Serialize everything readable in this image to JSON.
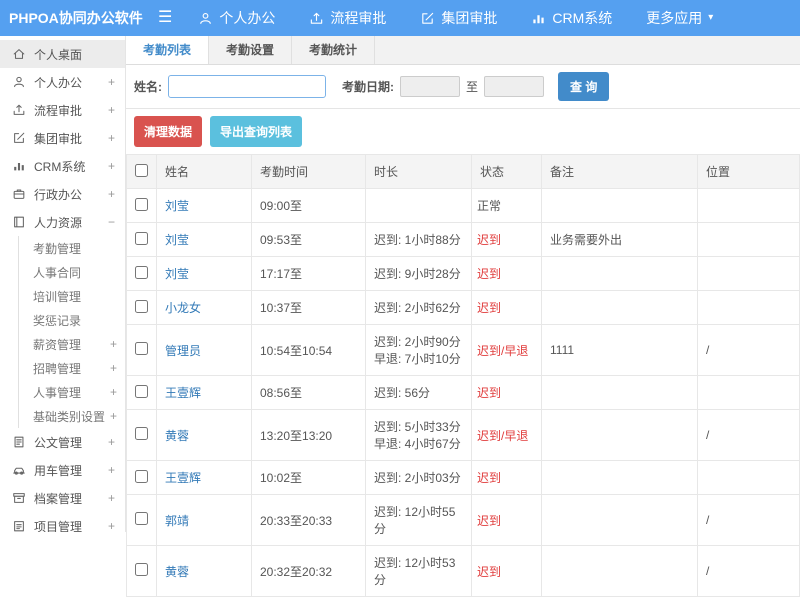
{
  "app": {
    "title": "PHPOA协同办公软件"
  },
  "topnav": {
    "menu_icon": "☰",
    "items": [
      {
        "label": "个人办公",
        "icon": "user"
      },
      {
        "label": "流程审批",
        "icon": "flow"
      },
      {
        "label": "集团审批",
        "icon": "edit"
      },
      {
        "label": "CRM系统",
        "icon": "chart"
      },
      {
        "label": "更多应用",
        "caret": "▾"
      }
    ]
  },
  "sidebar": {
    "items": [
      {
        "label": "个人桌面",
        "icon": "home",
        "cls": "active"
      },
      {
        "label": "个人办公",
        "icon": "user",
        "expand": "+"
      },
      {
        "label": "流程审批",
        "icon": "flow",
        "expand": "+"
      },
      {
        "label": "集团审批",
        "icon": "edit",
        "expand": "+"
      },
      {
        "label": "CRM系统",
        "icon": "chart",
        "expand": "+"
      },
      {
        "label": "行政办公",
        "icon": "briefcase",
        "expand": "+"
      },
      {
        "label": "人力资源",
        "icon": "book",
        "expand": "−"
      },
      {
        "label": "考勤管理",
        "cls": "sub"
      },
      {
        "label": "人事合同",
        "cls": "sub"
      },
      {
        "label": "培训管理",
        "cls": "sub"
      },
      {
        "label": "奖惩记录",
        "cls": "sub"
      },
      {
        "label": "薪资管理",
        "cls": "sub",
        "expand": "+"
      },
      {
        "label": "招聘管理",
        "cls": "sub",
        "expand": "+"
      },
      {
        "label": "人事管理",
        "cls": "sub",
        "expand": "+"
      },
      {
        "label": "基础类别设置",
        "cls": "sub",
        "expand": "+"
      },
      {
        "label": "公文管理",
        "icon": "doc",
        "expand": "+"
      },
      {
        "label": "用车管理",
        "icon": "car",
        "expand": "+"
      },
      {
        "label": "档案管理",
        "icon": "archive",
        "expand": "+"
      },
      {
        "label": "项目管理",
        "icon": "project",
        "expand": "+"
      }
    ]
  },
  "tabs": [
    {
      "label": "考勤列表",
      "cls": "active"
    },
    {
      "label": "考勤设置"
    },
    {
      "label": "考勤统计"
    }
  ],
  "filter": {
    "name_label": "姓名:",
    "date_label": "考勤日期:",
    "to_label": "至",
    "query_label": "查 询"
  },
  "actions": {
    "clear_label": "清理数据",
    "export_label": "导出查询列表"
  },
  "table": {
    "columns": [
      "姓名",
      "考勤时间",
      "时长",
      "状态",
      "备注",
      "位置"
    ],
    "rows": [
      {
        "name": "刘莹",
        "time": "09:00至",
        "duration": "",
        "status": "正常",
        "status_cls": "st-ok",
        "note": "",
        "location": ""
      },
      {
        "name": "刘莹",
        "time": "09:53至",
        "duration": "迟到: 1小时88分",
        "status": "迟到",
        "status_cls": "st-late",
        "note": "业务需要外出",
        "location": ""
      },
      {
        "name": "刘莹",
        "time": "17:17至",
        "duration": "迟到: 9小时28分",
        "status": "迟到",
        "status_cls": "st-late",
        "note": "",
        "location": ""
      },
      {
        "name": "小龙女",
        "time": "10:37至",
        "duration": "迟到: 2小时62分",
        "status": "迟到",
        "status_cls": "st-late",
        "note": "",
        "location": ""
      },
      {
        "name": "管理员",
        "time": "10:54至10:54",
        "duration": "迟到: 2小时90分\n早退: 7小时10分",
        "status": "迟到/早退",
        "status_cls": "st-late",
        "note": "1111",
        "location": "/"
      },
      {
        "name": "王壹辉",
        "time": "08:56至",
        "duration": "迟到: 56分",
        "status": "迟到",
        "status_cls": "st-late",
        "note": "",
        "location": ""
      },
      {
        "name": "黄蓉",
        "time": "13:20至13:20",
        "duration": "迟到: 5小时33分\n早退: 4小时67分",
        "status": "迟到/早退",
        "status_cls": "st-late",
        "note": "",
        "location": "/"
      },
      {
        "name": "王壹辉",
        "time": "10:02至",
        "duration": "迟到: 2小时03分",
        "status": "迟到",
        "status_cls": "st-late",
        "note": "",
        "location": ""
      },
      {
        "name": "郭靖",
        "time": "20:33至20:33",
        "duration": "迟到: 12小时55\n分",
        "status": "迟到",
        "status_cls": "st-late",
        "note": "",
        "location": "/"
      },
      {
        "name": "黄蓉",
        "time": "20:32至20:32",
        "duration": "迟到: 12小时53\n分",
        "status": "迟到",
        "status_cls": "st-late",
        "note": "",
        "location": "/"
      }
    ]
  },
  "colors": {
    "topbar_blue": "#55a0f0",
    "primary_blue": "#428bca",
    "link_blue": "#337ab7",
    "danger_red": "#d9534f",
    "status_red": "#e03b3b",
    "info_cyan": "#5bc0de"
  }
}
